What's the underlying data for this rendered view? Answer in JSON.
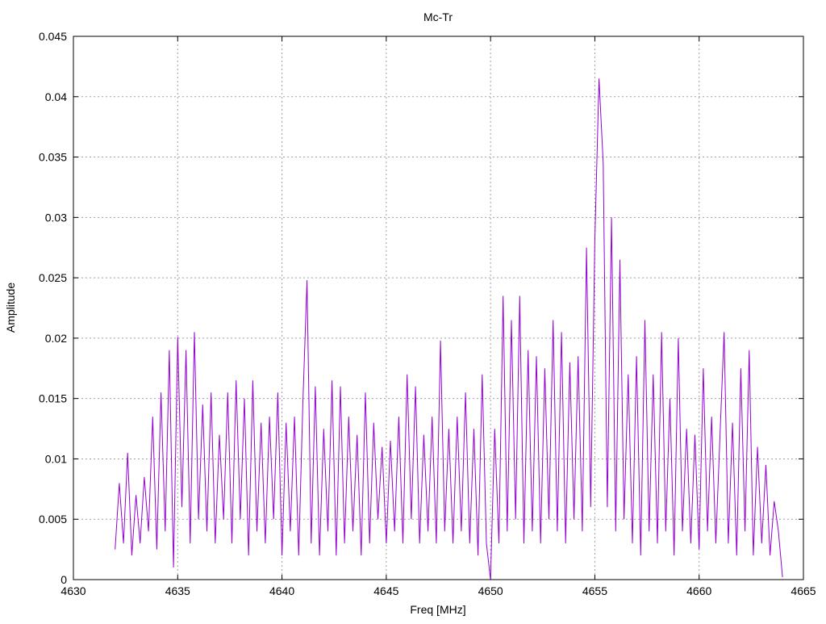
{
  "chart_data": {
    "type": "line",
    "title": "Mc-Tr",
    "xlabel": "Freq [MHz]",
    "ylabel": "Amplitude",
    "xlim": [
      4630,
      4665
    ],
    "ylim": [
      0,
      0.045
    ],
    "xticks": [
      "4630",
      "4635",
      "4640",
      "4645",
      "4650",
      "4655",
      "4660",
      "4665"
    ],
    "yticks": [
      "0",
      "0.005",
      "0.01",
      "0.015",
      "0.02",
      "0.025",
      "0.03",
      "0.035",
      "0.04",
      "0.045"
    ],
    "grid": true,
    "color": "#9400d3",
    "series": [
      {
        "name": "Mc-Tr",
        "x_start": 4632.0,
        "x_step": 0.2,
        "values": [
          0.0025,
          0.008,
          0.003,
          0.0105,
          0.002,
          0.007,
          0.003,
          0.0085,
          0.004,
          0.0135,
          0.0025,
          0.0155,
          0.004,
          0.019,
          0.001,
          0.0201,
          0.006,
          0.019,
          0.003,
          0.0205,
          0.005,
          0.0145,
          0.004,
          0.0155,
          0.003,
          0.012,
          0.005,
          0.0155,
          0.003,
          0.0165,
          0.005,
          0.015,
          0.002,
          0.0165,
          0.004,
          0.013,
          0.003,
          0.0135,
          0.005,
          0.0155,
          0.002,
          0.013,
          0.004,
          0.0135,
          0.002,
          0.0145,
          0.0248,
          0.003,
          0.016,
          0.002,
          0.0125,
          0.004,
          0.0165,
          0.002,
          0.016,
          0.003,
          0.0135,
          0.004,
          0.012,
          0.002,
          0.0155,
          0.003,
          0.013,
          0.005,
          0.011,
          0.003,
          0.0115,
          0.004,
          0.0135,
          0.003,
          0.017,
          0.005,
          0.016,
          0.003,
          0.012,
          0.004,
          0.0135,
          0.003,
          0.0198,
          0.004,
          0.0125,
          0.003,
          0.0135,
          0.004,
          0.0155,
          0.003,
          0.0125,
          0.002,
          0.017,
          0.003,
          0.0,
          0.0125,
          0.003,
          0.0235,
          0.004,
          0.0215,
          0.005,
          0.0235,
          0.003,
          0.019,
          0.004,
          0.0185,
          0.003,
          0.0175,
          0.005,
          0.0215,
          0.004,
          0.0205,
          0.003,
          0.018,
          0.005,
          0.0185,
          0.004,
          0.0275,
          0.006,
          0.028,
          0.0415,
          0.0345,
          0.006,
          0.03,
          0.004,
          0.0265,
          0.005,
          0.017,
          0.003,
          0.0185,
          0.002,
          0.0215,
          0.004,
          0.017,
          0.003,
          0.0205,
          0.004,
          0.015,
          0.002,
          0.02,
          0.004,
          0.0125,
          0.003,
          0.012,
          0.0025,
          0.0175,
          0.004,
          0.0135,
          0.003,
          0.012,
          0.0205,
          0.003,
          0.013,
          0.002,
          0.0175,
          0.004,
          0.019,
          0.002,
          0.011,
          0.003,
          0.0095,
          0.002,
          0.0065,
          0.004,
          0.0002
        ]
      }
    ]
  }
}
